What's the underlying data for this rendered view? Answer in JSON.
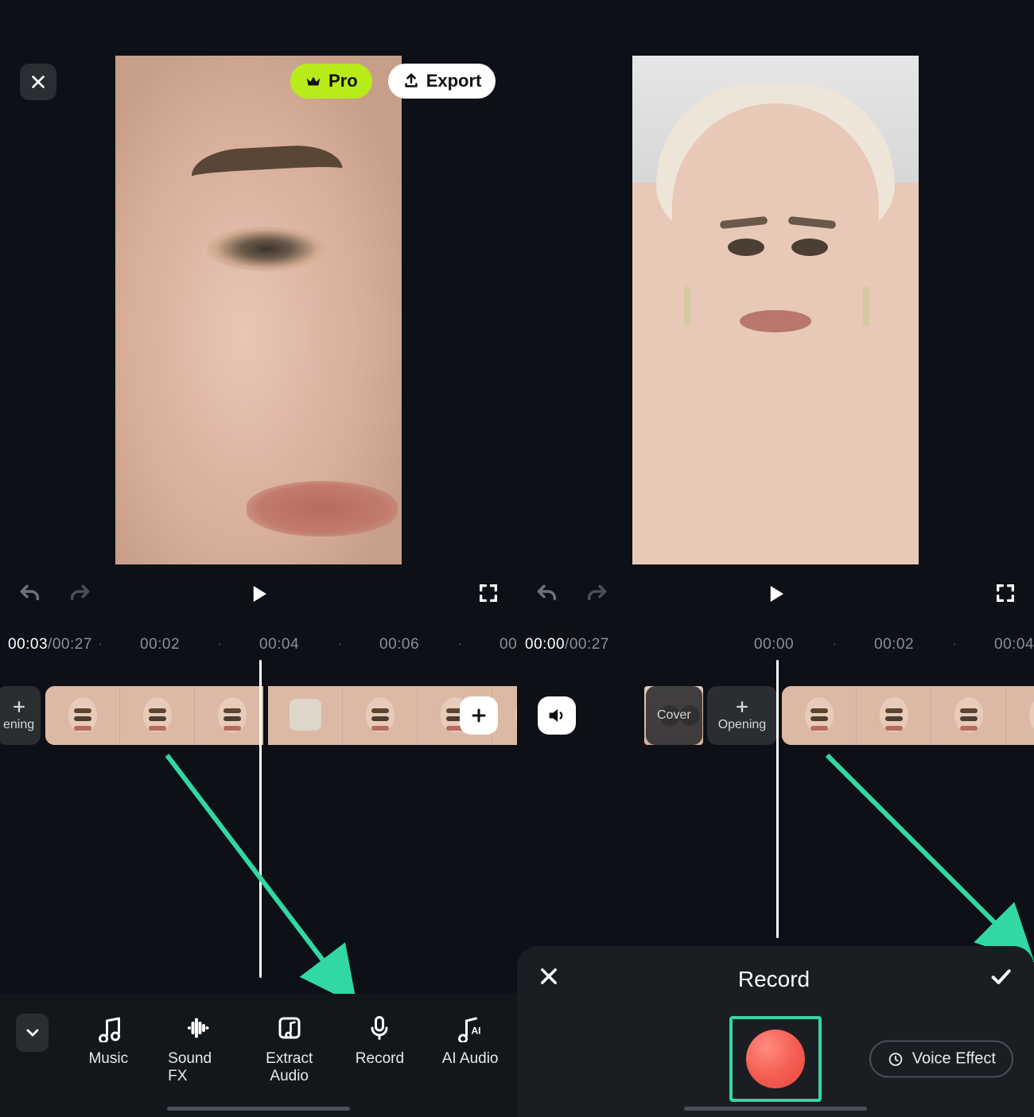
{
  "left": {
    "close": "✕",
    "pro_label": "Pro",
    "export_label": "Export",
    "time_current": "00:03",
    "time_total": "/00:27",
    "ruler": [
      "00:02",
      "00:04",
      "00:06",
      "00"
    ],
    "timeline": {
      "opening_short": "ening",
      "add": "+",
      "mute": "speaker"
    },
    "tools": {
      "music": "Music",
      "soundfx": "Sound FX",
      "extract": "Extract Audio",
      "record": "Record",
      "ai_audio": "AI Audio"
    }
  },
  "right": {
    "time_current": "00:00",
    "time_total": "/00:27",
    "ruler": [
      "00:00",
      "00:02",
      "00:04"
    ],
    "timeline": {
      "cover": "Cover",
      "opening": "Opening"
    },
    "record_panel": {
      "title": "Record",
      "voice_effect": "Voice Effect"
    }
  }
}
